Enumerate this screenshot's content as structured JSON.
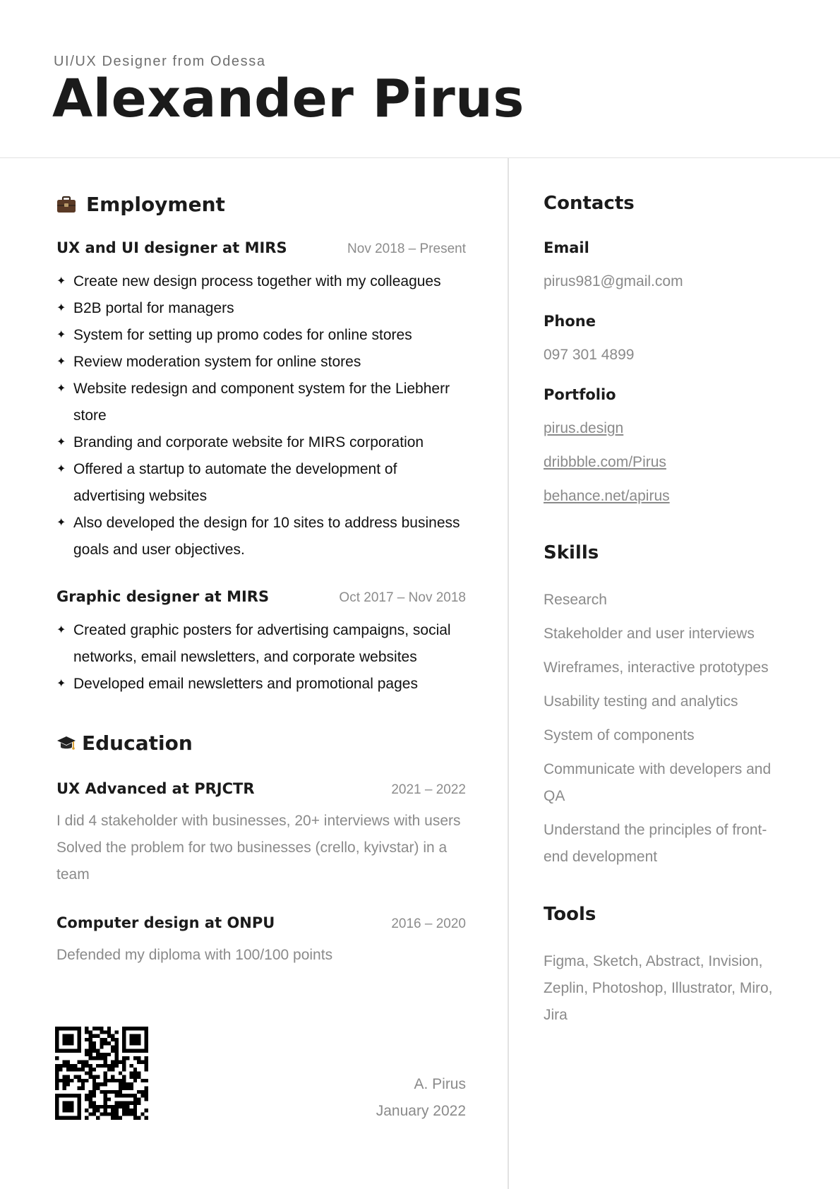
{
  "header": {
    "subtitle": "UI/UX Designer from Odessa",
    "name": "Alexander Pirus"
  },
  "employment": {
    "title": "Employment",
    "icon": "briefcase-icon",
    "jobs": [
      {
        "title": "UX and UI designer at MIRS",
        "date": "Nov 2018 – Present",
        "bullets": [
          "Create new design process together with my colleagues",
          "B2B portal for managers",
          "System for setting up promo codes for online stores",
          "Review moderation system for online stores",
          "Website redesign and component system for the Liebherr store",
          "Branding and corporate website for MIRS corporation",
          "Offered a startup to automate the development of advertising websites",
          "Also developed the design for 10 sites to address business goals and user objectives."
        ]
      },
      {
        "title": "Graphic designer at MIRS",
        "date": "Oct 2017 – Nov 2018",
        "bullets": [
          "Created graphic posters for advertising campaigns, social networks, email newsletters, and corporate websites",
          "Developed email newsletters and promotional pages"
        ]
      }
    ]
  },
  "education": {
    "title": "Education",
    "icon": "graduation-cap-icon",
    "items": [
      {
        "title": "UX Advanced at PRJCTR",
        "date": "2021 – 2022",
        "text": "I did 4 stakeholder with businesses, 20+ interviews with users Solved the problem for two businesses (crello, kyivstar) in a team"
      },
      {
        "title": "Computer design at ONPU",
        "date": "2016 – 2020",
        "text": "Defended my diploma with 100/100 points"
      }
    ]
  },
  "signature": {
    "name": "A. Pirus",
    "date": "January 2022"
  },
  "contacts": {
    "title": "Contacts",
    "email_label": "Email",
    "email": "pirus981@gmail.com",
    "phone_label": "Phone",
    "phone": "097 301 4899",
    "portfolio_label": "Portfolio",
    "links": [
      "pirus.design",
      "dribbble.com/Pirus",
      "behance.net/apirus"
    ]
  },
  "skills": {
    "title": "Skills",
    "items": [
      "Research",
      "Stakeholder and user interviews",
      "Wireframes, interactive prototypes",
      "Usability testing and analytics",
      "System of components",
      "Communicate with developers and QA",
      "Understand the principles of front-end development"
    ]
  },
  "tools": {
    "title": "Tools",
    "text": "Figma, Sketch, Abstract, Invision, Zeplin, Photoshop, Illustrator, Miro, Jira"
  }
}
